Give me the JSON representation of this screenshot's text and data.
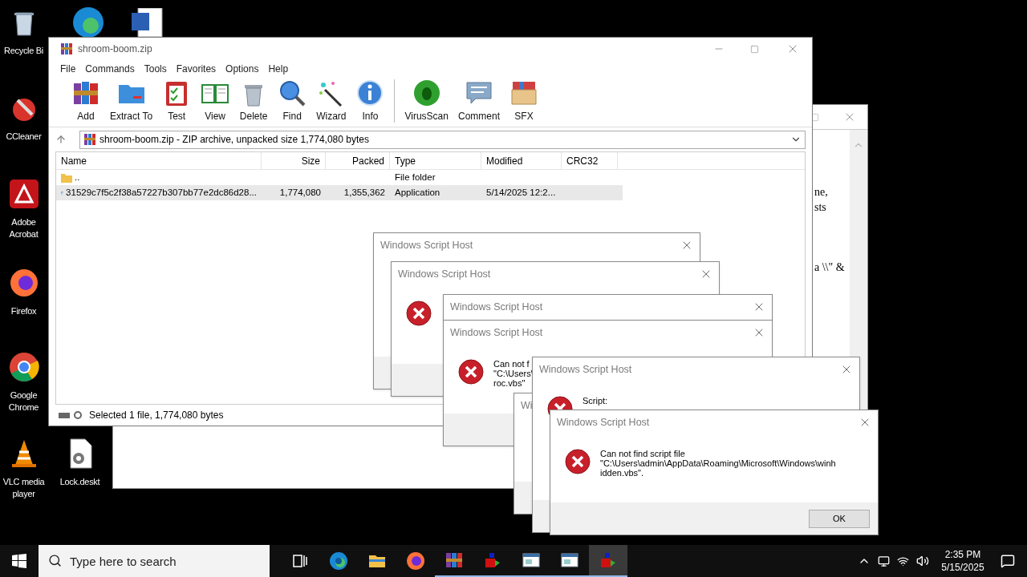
{
  "desktop_icons": [
    {
      "label": "Recycle Bi",
      "kind": "bin"
    },
    {
      "label": "CCleaner",
      "kind": "ccleaner"
    },
    {
      "label": "Adobe Acrobat",
      "kind": "acrobat"
    },
    {
      "label": "Firefox",
      "kind": "firefox"
    },
    {
      "label": "Google Chrome",
      "kind": "chrome"
    },
    {
      "label": "VLC media player",
      "kind": "vlc"
    },
    {
      "label": "Lock.deskt",
      "kind": "file"
    }
  ],
  "background_window": {
    "lines": [
      "ne,",
      "sts",
      "a \\\\\" &"
    ]
  },
  "winrar": {
    "title": "shroom-boom.zip",
    "menu": [
      "File",
      "Commands",
      "Tools",
      "Favorites",
      "Options",
      "Help"
    ],
    "toolbar": [
      {
        "label": "Add",
        "kind": "add"
      },
      {
        "label": "Extract To",
        "kind": "extract"
      },
      {
        "label": "Test",
        "kind": "test"
      },
      {
        "label": "View",
        "kind": "view"
      },
      {
        "label": "Delete",
        "kind": "delete"
      },
      {
        "label": "Find",
        "kind": "find"
      },
      {
        "label": "Wizard",
        "kind": "wizard"
      },
      {
        "label": "Info",
        "kind": "info"
      },
      {
        "label": "VirusScan",
        "kind": "virus"
      },
      {
        "label": "Comment",
        "kind": "comment"
      },
      {
        "label": "SFX",
        "kind": "sfx"
      }
    ],
    "address": "shroom-boom.zip - ZIP archive, unpacked size 1,774,080 bytes",
    "columns": [
      "Name",
      "Size",
      "Packed",
      "Type",
      "Modified",
      "CRC32"
    ],
    "rows": [
      {
        "kind": "folder",
        "selected": false,
        "cells": [
          "..",
          "",
          "",
          "File folder",
          "",
          ""
        ]
      },
      {
        "kind": "app",
        "selected": true,
        "cells": [
          "31529c7f5c2f38a57227b307bb77e2dc86d28...",
          "1,774,080",
          "1,355,362",
          "Application",
          "5/14/2025 12:2...",
          ""
        ]
      }
    ],
    "status": "Selected 1 file, 1,774,080 bytes"
  },
  "dialogs": [
    {
      "title": "Windows Script Host",
      "error": false
    },
    {
      "title": "Windows Script Host",
      "error": true
    },
    {
      "title": "Windows Script Host",
      "error": false
    },
    {
      "title": "Windows Script Host",
      "error": true,
      "message": [
        "Can not f",
        "\"C:\\Users\\",
        "roc.vbs\""
      ]
    },
    {
      "title": "Wi",
      "error": false
    },
    {
      "title": "Windows Script Host",
      "error": true,
      "message": [
        "Script:"
      ]
    },
    {
      "title": "Windows Script Host",
      "error": true,
      "message": [
        "Can not find script file",
        "\"C:\\Users\\admin\\AppData\\Roaming\\Microsoft\\Windows\\winh",
        "idden.vbs\"."
      ],
      "button": "OK"
    }
  ],
  "taskbar": {
    "search": {
      "placeholder": "Type here to search"
    },
    "apps": [
      {
        "kind": "taskview",
        "running": false,
        "selected": false
      },
      {
        "kind": "edge",
        "running": false,
        "selected": false
      },
      {
        "kind": "explorer",
        "running": false,
        "selected": false
      },
      {
        "kind": "firefox",
        "running": false,
        "selected": false
      },
      {
        "kind": "winrar",
        "running": true,
        "selected": false
      },
      {
        "kind": "script",
        "running": true,
        "selected": false
      },
      {
        "kind": "window",
        "running": true,
        "selected": false
      },
      {
        "kind": "window",
        "running": true,
        "selected": false
      },
      {
        "kind": "script",
        "running": true,
        "selected": true
      }
    ],
    "time": "2:35 PM",
    "date": "5/15/2025"
  }
}
